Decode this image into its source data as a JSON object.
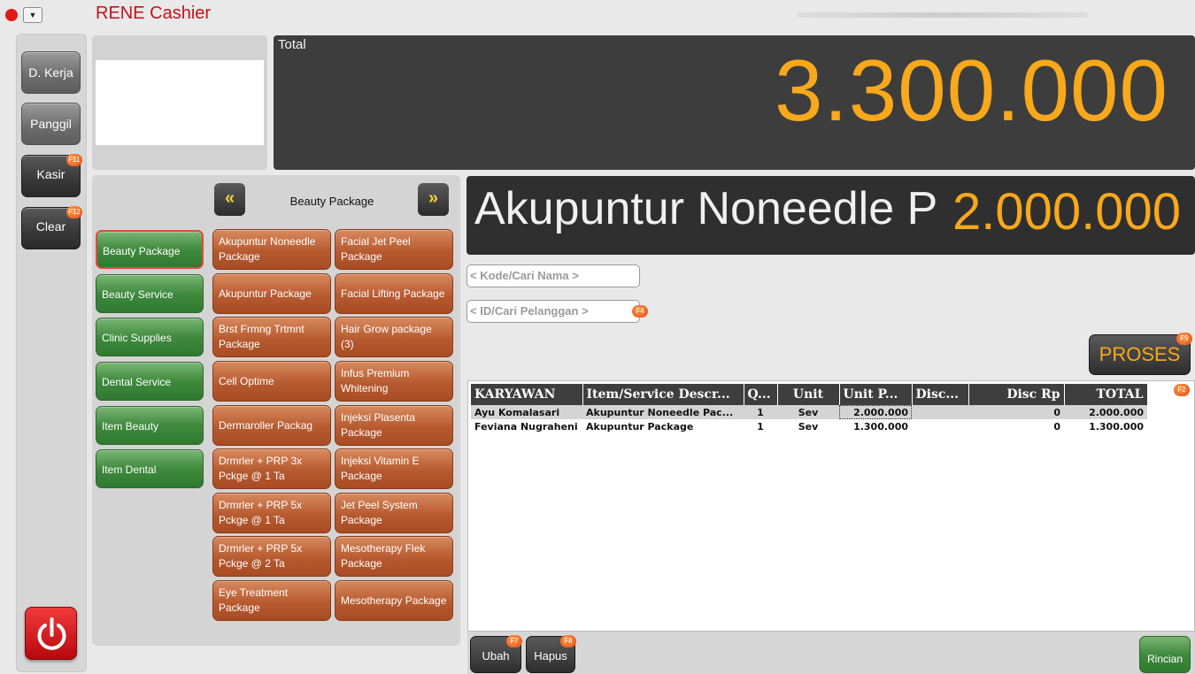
{
  "window": {
    "title": "RENE Cashier"
  },
  "left_buttons": [
    {
      "label": "D. Kerja",
      "key": ""
    },
    {
      "label": "Panggil",
      "key": ""
    },
    {
      "label": "Kasir",
      "key": "F11"
    },
    {
      "label": "Clear",
      "key": "F12"
    }
  ],
  "total": {
    "label": "Total",
    "value": "3.300.000"
  },
  "current_item": {
    "name": "Akupuntur Noneedle P",
    "price": "2.000.000"
  },
  "categories": [
    "Beauty Package",
    "Beauty Service",
    "Clinic Supplies",
    "Dental Service",
    "Item Beauty",
    "Item Dental"
  ],
  "category_nav": {
    "title": "Beauty Package",
    "prev": "«",
    "next": "»"
  },
  "packages_left": [
    "Akupuntur Noneedle Package",
    "Akupuntur Package",
    "Brst Frmng Trtmnt Package",
    "Cell Optime",
    "Dermaroller Packag",
    "Drmrler + PRP 3x Pckge @ 1 Ta",
    "Drmrler + PRP 5x Pckge @ 1 Ta",
    "Drmrler + PRP 5x Pckge @ 2 Ta",
    "Eye Treatment Package"
  ],
  "packages_right": [
    "Facial Jet Peel Package",
    "Facial Lifting Package",
    "Hair Grow package (3)",
    "Infus Premium Whitening",
    "Injeksi Plasenta Package",
    "Injeksi Vitamin E Package",
    "Jet Peel System Package",
    "Mesotherapy Flek Package",
    "Mesotherapy Package"
  ],
  "search": {
    "code_placeholder": "< Kode/Cari Nama >",
    "customer_placeholder": "< ID/Cari Pelanggan >",
    "customer_key": "F4"
  },
  "proses": {
    "label": "PROSES",
    "key": "F9"
  },
  "table": {
    "columns": [
      "KARYAWAN",
      "Item/Service Descr...",
      "Q...",
      "Unit",
      "Unit P...",
      "Disc...",
      "Disc Rp",
      "TOTAL"
    ],
    "key": "F2",
    "rows": [
      {
        "karyawan": "Ayu Komalasari",
        "item": "Akupuntur Noneedle Pac...",
        "qty": "1",
        "unit": "Sev",
        "unit_price": "2.000.000",
        "disc": "",
        "disc_rp": "0",
        "total": "2.000.000"
      },
      {
        "karyawan": "Feviana Nugraheni",
        "item": "Akupuntur Package",
        "qty": "1",
        "unit": "Sev",
        "unit_price": "1.300.000",
        "disc": "",
        "disc_rp": "0",
        "total": "1.300.000"
      }
    ]
  },
  "bottom": {
    "ubah": {
      "label": "Ubah",
      "key": "F7"
    },
    "hapus": {
      "label": "Hapus",
      "key": "F8"
    },
    "rincian": "Rincian"
  }
}
